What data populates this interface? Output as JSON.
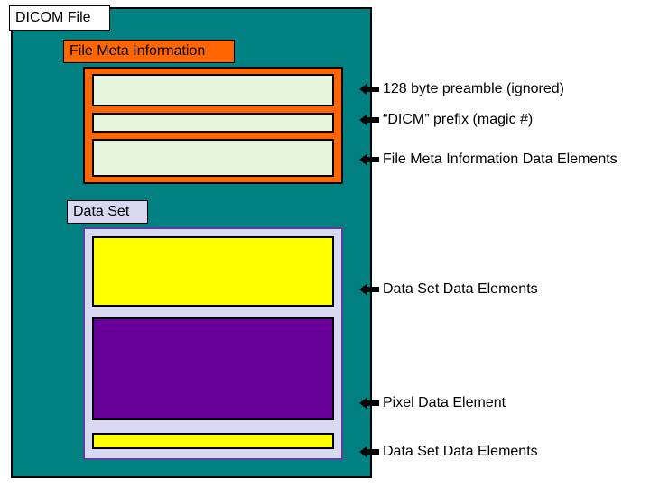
{
  "titles": {
    "dicom_file": "DICOM File",
    "file_meta": "File Meta Information",
    "data_set": "Data Set"
  },
  "labels": {
    "preamble": "128 byte preamble (ignored)",
    "dicm_prefix": "“DICM” prefix (magic #)",
    "meta_data_elements": "File Meta Information Data Elements",
    "dataset_elements1": "Data Set Data Elements",
    "pixel_data": "Pixel Data Element",
    "dataset_elements2": "Data Set Data Elements"
  },
  "chart_data": {
    "type": "diagram",
    "title": "DICOM File structure",
    "components": [
      {
        "name": "DICOM File",
        "children": [
          {
            "name": "File Meta Information",
            "children": [
              {
                "name": "128 byte preamble (ignored)"
              },
              {
                "name": "\"DICM\" prefix (magic #)"
              },
              {
                "name": "File Meta Information Data Elements"
              }
            ]
          },
          {
            "name": "Data Set",
            "children": [
              {
                "name": "Data Set Data Elements"
              },
              {
                "name": "Pixel Data Element"
              },
              {
                "name": "Data Set Data Elements"
              }
            ]
          }
        ]
      }
    ]
  }
}
